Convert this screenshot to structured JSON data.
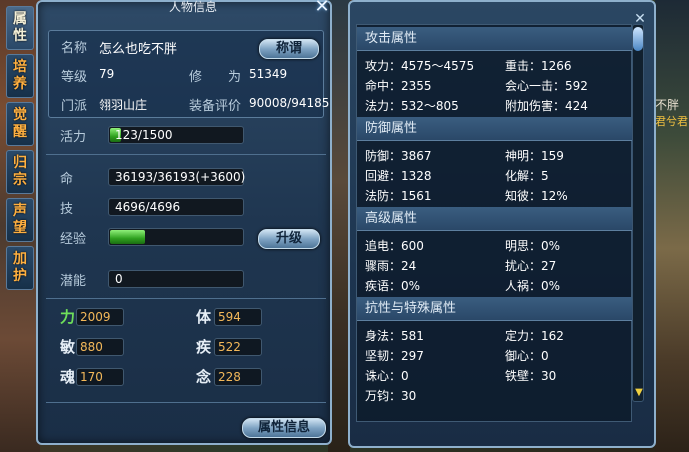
{
  "side_tabs": [
    "属性",
    "培养",
    "觉醒",
    "归宗",
    "声望",
    "加护"
  ],
  "character_panel": {
    "title": "人物信息",
    "rows": {
      "name_label": "名称",
      "name_value": "怎么也吃不胖",
      "title_button": "称谓",
      "level_label": "等级",
      "level_value": "79",
      "cultivation_label": "修　　为",
      "cultivation_value": "51349",
      "sect_label": "门派",
      "sect_value": "翎羽山庄",
      "equip_label": "装备评价",
      "equip_value": "90008/94185",
      "vitality_label": "活力",
      "vitality_value": "123/1500"
    },
    "bars": {
      "hp_label": "命",
      "hp_value": "36193/36193(+3600)",
      "skill_label": "技",
      "skill_value": "4696/4696",
      "exp_label": "经验",
      "upgrade_button": "升级",
      "potential_label": "潜能",
      "potential_value": "0"
    },
    "progress": {
      "vitality_fraction": 0.082,
      "exp_fraction": 0.26
    },
    "stats": {
      "str_label": "力",
      "str_value": "2009",
      "con_label": "体",
      "con_value": "594",
      "agi_label": "敏",
      "agi_value": "880",
      "spd_label": "疾",
      "spd_value": "522",
      "soul_label": "魂",
      "soul_value": "170",
      "mind_label": "念",
      "mind_value": "228"
    },
    "attr_button": "属性信息"
  },
  "attribute_panel": {
    "sections": {
      "attack": {
        "title": "攻击属性",
        "rows": [
          {
            "left": "攻力：4575～4575",
            "right": "重击：1266"
          },
          {
            "left": "命中：2355",
            "right": "会心一击：592"
          },
          {
            "left": "法力：532～805",
            "right": "附加伤害：424"
          }
        ]
      },
      "defense": {
        "title": "防御属性",
        "rows": [
          {
            "left": "防御：3867",
            "right": "神明：159"
          },
          {
            "left": "回避：1328",
            "right": "化解：5"
          },
          {
            "left": "法防：1561",
            "right": "知彼：12%"
          }
        ]
      },
      "advanced": {
        "title": "高级属性",
        "rows": [
          {
            "left": "追电：600",
            "right": "明思：0%"
          },
          {
            "left": "骤雨：24",
            "right": "扰心：27"
          },
          {
            "left": "疾语：0%",
            "right": "人祸：0%"
          }
        ]
      },
      "resist": {
        "title": "抗性与特殊属性",
        "rows": [
          {
            "left": "身法：581",
            "right": "定力：162"
          },
          {
            "left": "坚韧：297",
            "right": "御心：0"
          },
          {
            "left": "诛心：0",
            "right": "铁壁：30"
          },
          {
            "left": "万钧：30",
            "right": ""
          }
        ]
      }
    }
  },
  "scene": {
    "right_name": "不胖",
    "right_sub": "君兮君"
  }
}
